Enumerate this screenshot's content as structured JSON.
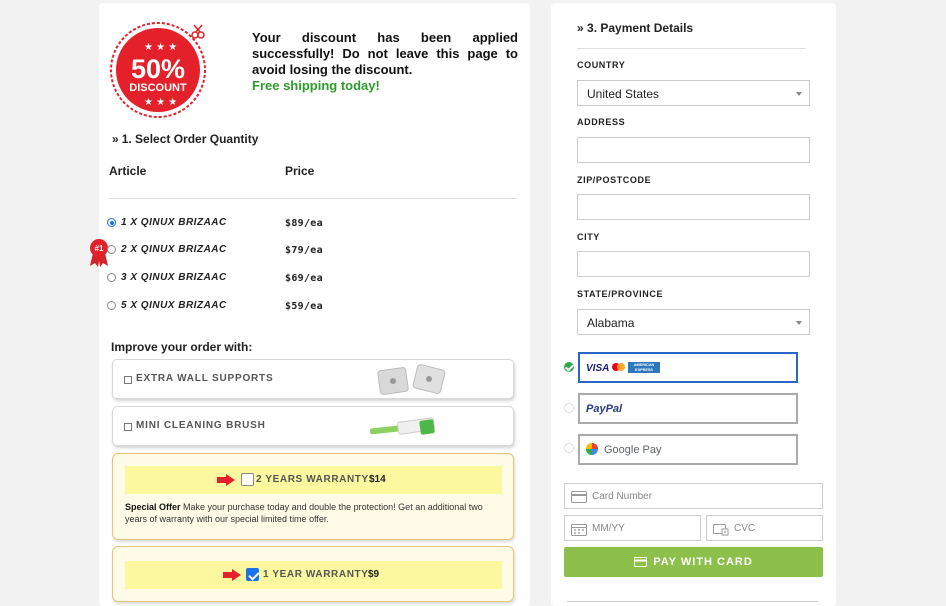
{
  "badge": {
    "percent": "50%",
    "word": "DISCOUNT"
  },
  "notice": {
    "message": "Your discount has been applied successfully! Do not leave this page to avoid losing the discount.",
    "shipping": "Free shipping today!"
  },
  "order": {
    "section_title": "1. Select Order Quantity",
    "col_article": "Article",
    "col_price": "Price",
    "rank_label": "#1",
    "options": [
      {
        "label": "1 X QINUX BRIZAAC",
        "price": "$89/ea",
        "selected": true
      },
      {
        "label": "2 X QINUX BRIZAAC",
        "price": "$79/ea",
        "selected": false
      },
      {
        "label": "3 X QINUX BRIZAAC",
        "price": "$69/ea",
        "selected": false
      },
      {
        "label": "5 X QINUX BRIZAAC",
        "price": "$59/ea",
        "selected": false
      }
    ]
  },
  "improve": {
    "title": "Improve your order with:",
    "addons": [
      {
        "label": "EXTRA WALL SUPPORTS",
        "checked": false
      },
      {
        "label": "MINI CLEANING BRUSH",
        "checked": false
      }
    ],
    "warranty2": {
      "label": "2 YEARS WARRANTY",
      "price": "$14",
      "checked": false,
      "offer_bold": "Special Offer",
      "offer_text": "Make your purchase today and double the protection! Get an additional two years of warranty with our special limited time offer."
    },
    "warranty1": {
      "label": "1 YEAR WARRANTY",
      "price": "$9",
      "checked": true
    }
  },
  "payment": {
    "section_title": "3. Payment Details",
    "country_label": "COUNTRY",
    "country_value": "United States",
    "address_label": "ADDRESS",
    "zip_label": "ZIP/POSTCODE",
    "city_label": "CITY",
    "state_label": "STATE/PROVINCE",
    "state_value": "Alabama",
    "methods": [
      {
        "name": "VISA",
        "extra": "AMERICAN EXPRESS",
        "selected": true
      },
      {
        "name": "PayPal",
        "selected": false
      },
      {
        "name": "Google Pay",
        "selected": false
      }
    ],
    "card_number_placeholder": "Card Number",
    "expiry_placeholder": "MM/YY",
    "cvc_placeholder": "CVC",
    "pay_button": "PAY WITH CARD"
  },
  "colors": {
    "accent_green": "#8cc04b",
    "badge_red": "#e4202a",
    "selected_blue": "#2a66c8"
  }
}
